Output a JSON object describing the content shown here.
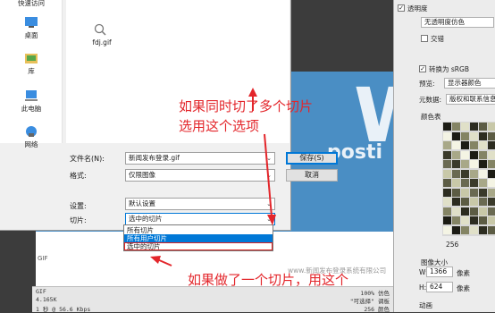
{
  "dialog": {
    "nav": [
      "快速访问",
      "桌面",
      "库",
      "此电脑",
      "网络"
    ],
    "file": {
      "name": "fdj.gif"
    },
    "labels": {
      "filename": "文件名(N):",
      "format": "格式:",
      "settings": "设置:",
      "slices": "切片:"
    },
    "filename_value": "新闻发布登录.gif",
    "format_value": "仅限图像",
    "settings_value": "默认设置",
    "slices_value": "选中的切片",
    "save_button": "保存(S)",
    "cancel_button": "取消",
    "slice_options": [
      "所有切片",
      "所有用户切片",
      "选中的切片"
    ]
  },
  "preview": {
    "big_letter": "W",
    "word": "posti",
    "watermark": "www.新闻发布登录系统有限公司",
    "gif_label": "GIF",
    "info_left": [
      "GIF",
      "4.165K",
      "1 秒 @ 56.6 Kbps"
    ],
    "info_right": [
      "100% 仿色",
      "\"可选择\" 调板",
      "256 颜色"
    ]
  },
  "right_panel": {
    "transparency": "透明度",
    "no_transparency_dither": "无透明度仿色",
    "interlaced": "交错",
    "convert_srgb": "转换为 sRGB",
    "preview_label": "预览:",
    "preview_value": "显示器颜色",
    "metadata_label": "元数据:",
    "metadata_value": "版权和联系信息",
    "color_table": "颜色表",
    "color_count": "256",
    "image_size": "图像大小",
    "w_label": "W:",
    "w_value": "1366",
    "h_label": "H:",
    "h_value": "624",
    "unit": "像素",
    "animation": "动画"
  },
  "annotations": {
    "top": [
      "如果同时切了多个切片",
      "选用这个选项"
    ],
    "bottom": "如果做了一个切片，用这个"
  },
  "colors": {
    "accent": "#0078d7",
    "annotation": "#e3262b",
    "preview_blue": "#4a8ec4"
  }
}
